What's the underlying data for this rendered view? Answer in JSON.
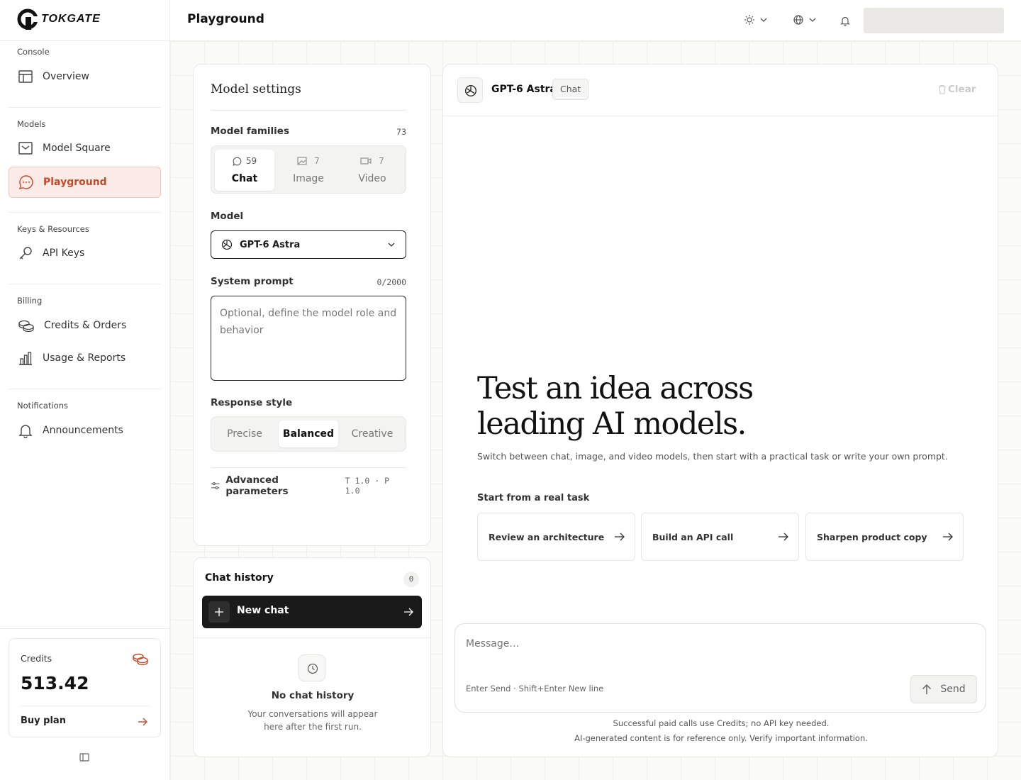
{
  "brand": {
    "name": "TOKGATE"
  },
  "header": {
    "title": "Playground"
  },
  "sidebar": {
    "sections": [
      {
        "label": "Console",
        "items": [
          {
            "label": "Overview",
            "icon": "layout-icon"
          }
        ]
      },
      {
        "label": "Models",
        "items": [
          {
            "label": "Model Square",
            "icon": "inbox-icon"
          },
          {
            "label": "Playground",
            "icon": "chat-bubble-icon",
            "active": true
          }
        ]
      },
      {
        "label": "Keys & Resources",
        "items": [
          {
            "label": "API Keys",
            "icon": "key-icon"
          }
        ]
      },
      {
        "label": "Billing",
        "items": [
          {
            "label": "Credits & Orders",
            "icon": "coins-icon"
          },
          {
            "label": "Usage & Reports",
            "icon": "bar-chart-icon"
          }
        ]
      },
      {
        "label": "Notifications",
        "items": [
          {
            "label": "Announcements",
            "icon": "bell-icon"
          }
        ]
      }
    ],
    "credits": {
      "label": "Credits",
      "value": "513.42",
      "buy_label": "Buy plan"
    }
  },
  "settings": {
    "title": "Model settings",
    "families_label": "Model families",
    "families_count": "73",
    "family_tabs": [
      {
        "label": "Chat",
        "count": "59",
        "active": true
      },
      {
        "label": "Image",
        "count": "7"
      },
      {
        "label": "Video",
        "count": "7"
      }
    ],
    "model_label": "Model",
    "model_value": "GPT-6 Astra",
    "system_prompt_label": "System prompt",
    "system_prompt_count": "0/2000",
    "system_prompt_placeholder": "Optional, define the model role and behavior",
    "response_style_label": "Response style",
    "response_styles": [
      {
        "label": "Precise"
      },
      {
        "label": "Balanced",
        "active": true
      },
      {
        "label": "Creative"
      }
    ],
    "advanced_label": "Advanced parameters",
    "advanced_values": "T 1.0 · P 1.0"
  },
  "history": {
    "title": "Chat history",
    "count": "0",
    "new_chat_label": "New chat",
    "empty_title": "No chat history",
    "empty_desc_1": "Your conversations will appear",
    "empty_desc_2": "here after the first run."
  },
  "chat": {
    "model_name": "GPT-6 Astra",
    "mode_badge": "Chat",
    "clear_label": "Clear",
    "hero_line1": "Test an idea across",
    "hero_line2": "leading AI models.",
    "hero_sub": "Switch between chat, image, and video models, then start with a practical task or write your own prompt.",
    "tasks_label": "Start from a real task",
    "tasks": [
      {
        "label": "Review an architecture"
      },
      {
        "label": "Build an API call"
      },
      {
        "label": "Sharpen product copy"
      }
    ],
    "input_placeholder": "Message…",
    "input_hint": "Enter Send · Shift+Enter New line",
    "send_label": "Send",
    "footer_1": "Successful paid calls use Credits; no API key needed.",
    "footer_2": "AI-generated content is for reference only. Verify important information."
  },
  "colors": {
    "accent": "#c24a2a",
    "accent_bg": "#fcebe6",
    "dark": "#1a1a1a"
  }
}
